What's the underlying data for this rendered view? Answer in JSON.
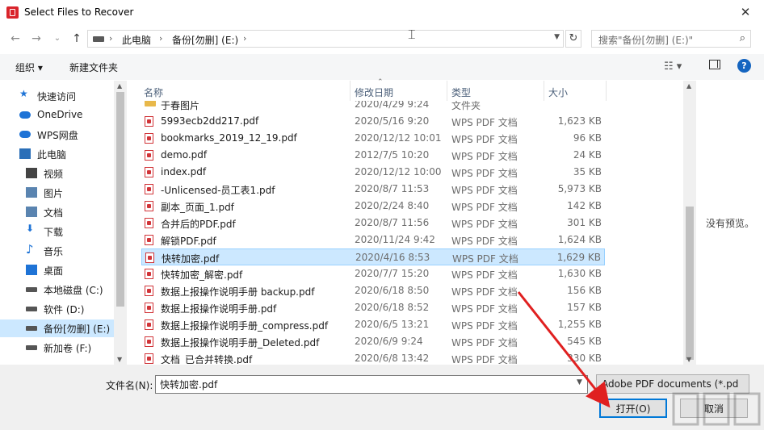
{
  "window": {
    "title": "Select Files to Recover",
    "close_glyph": "✕"
  },
  "nav": {
    "back": "←",
    "forward": "→",
    "history": "⌄",
    "up": "↑",
    "refresh": "↻"
  },
  "address": {
    "crumbs": [
      "此电脑",
      "备份[勿删] (E:)"
    ],
    "sep": "›"
  },
  "search": {
    "placeholder": "搜索\"备份[勿删] (E:)\"",
    "icon": "⌕"
  },
  "toolbar": {
    "organize": "组织 ▾",
    "new_folder": "新建文件夹",
    "view": "☷ ▾",
    "help": "?"
  },
  "sidebar": {
    "items": [
      {
        "label": "快速访问",
        "icon": "star-icon",
        "color": "#1e73d6"
      },
      {
        "label": "OneDrive",
        "icon": "cloud-icon",
        "color": "#1e73d6"
      },
      {
        "label": "WPS网盘",
        "icon": "cloud-icon",
        "color": "#1e73d6"
      },
      {
        "label": "此电脑",
        "icon": "computer-icon",
        "color": "#2b6fb8"
      },
      {
        "label": "视频",
        "icon": "video-icon",
        "color": "#444444"
      },
      {
        "label": "图片",
        "icon": "picture-icon",
        "color": "#5a84b0"
      },
      {
        "label": "文档",
        "icon": "document-icon",
        "color": "#5a84b0"
      },
      {
        "label": "下载",
        "icon": "download-icon",
        "color": "#1e73d6"
      },
      {
        "label": "音乐",
        "icon": "music-icon",
        "color": "#1e73d6"
      },
      {
        "label": "桌面",
        "icon": "desktop-icon",
        "color": "#1e73d6"
      },
      {
        "label": "本地磁盘 (C:)",
        "icon": "drive-icon",
        "color": "#555555"
      },
      {
        "label": "软件 (D:)",
        "icon": "drive-icon",
        "color": "#555555"
      },
      {
        "label": "备份[勿删] (E:)",
        "icon": "drive-icon",
        "color": "#555555",
        "selected": true
      },
      {
        "label": "新加卷 (F:)",
        "icon": "drive-icon",
        "color": "#555555"
      }
    ]
  },
  "columns": {
    "name": "名称",
    "date": "修改日期",
    "type": "类型",
    "size": "大小"
  },
  "files": [
    {
      "name": "于春图片",
      "date": "2020/4/29 9:24",
      "type": "文件夹",
      "size": "",
      "folder": true
    },
    {
      "name": "5993ecb2dd217.pdf",
      "date": "2020/5/16 9:20",
      "type": "WPS PDF 文档",
      "size": "1,623 KB"
    },
    {
      "name": "bookmarks_2019_12_19.pdf",
      "date": "2020/12/12 10:01",
      "type": "WPS PDF 文档",
      "size": "96 KB"
    },
    {
      "name": "demo.pdf",
      "date": "2012/7/5 10:20",
      "type": "WPS PDF 文档",
      "size": "24 KB"
    },
    {
      "name": "index.pdf",
      "date": "2020/12/12 10:00",
      "type": "WPS PDF 文档",
      "size": "35 KB"
    },
    {
      "name": "-Unlicensed-员工表1.pdf",
      "date": "2020/8/7 11:53",
      "type": "WPS PDF 文档",
      "size": "5,973 KB"
    },
    {
      "name": "副本_页面_1.pdf",
      "date": "2020/2/24 8:40",
      "type": "WPS PDF 文档",
      "size": "142 KB"
    },
    {
      "name": "合并后的PDF.pdf",
      "date": "2020/8/7 11:56",
      "type": "WPS PDF 文档",
      "size": "301 KB"
    },
    {
      "name": "解锁PDF.pdf",
      "date": "2020/11/24 9:42",
      "type": "WPS PDF 文档",
      "size": "1,624 KB"
    },
    {
      "name": "快转加密.pdf",
      "date": "2020/4/16 8:53",
      "type": "WPS PDF 文档",
      "size": "1,629 KB",
      "selected": true
    },
    {
      "name": "快转加密_解密.pdf",
      "date": "2020/7/7 15:20",
      "type": "WPS PDF 文档",
      "size": "1,630 KB"
    },
    {
      "name": "数据上报操作说明手册 backup.pdf",
      "date": "2020/6/18 8:50",
      "type": "WPS PDF 文档",
      "size": "156 KB"
    },
    {
      "name": "数据上报操作说明手册.pdf",
      "date": "2020/6/18 8:52",
      "type": "WPS PDF 文档",
      "size": "157 KB"
    },
    {
      "name": "数据上报操作说明手册_compress.pdf",
      "date": "2020/6/5 13:21",
      "type": "WPS PDF 文档",
      "size": "1,255 KB"
    },
    {
      "name": "数据上报操作说明手册_Deleted.pdf",
      "date": "2020/6/9 9:24",
      "type": "WPS PDF 文档",
      "size": "545 KB"
    },
    {
      "name": "文档_已合并转换.pdf",
      "date": "2020/6/8 13:42",
      "type": "WPS PDF 文档",
      "size": "330 KB"
    }
  ],
  "preview": {
    "empty_text": "没有预览。"
  },
  "footer": {
    "filename_label": "文件名(N):",
    "filename_value": "快转加密.pdf",
    "filter_value": "Adobe PDF documents (*.pd",
    "open_label": "打开(O)",
    "cancel_label": "取消"
  },
  "colors": {
    "accent": "#0078d7",
    "selection": "#cce8ff",
    "annotation_arrow": "#e02020"
  }
}
